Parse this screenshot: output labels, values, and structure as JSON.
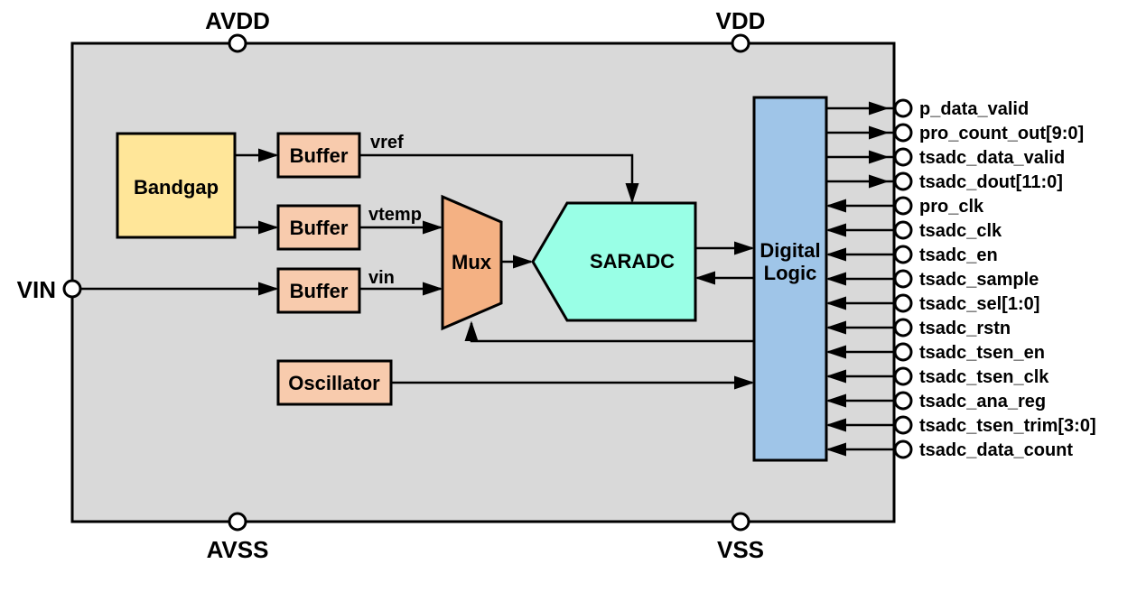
{
  "pins": {
    "avdd": "AVDD",
    "vdd": "VDD",
    "avss": "AVSS",
    "vss": "VSS",
    "vin": "VIN"
  },
  "blocks": {
    "bandgap": "Bandgap",
    "buffer1": "Buffer",
    "buffer2": "Buffer",
    "buffer3": "Buffer",
    "mux": "Mux",
    "saradc": "SARADC",
    "digital_logic_line1": "Digital",
    "digital_logic_line2": "Logic",
    "oscillator": "Oscillator"
  },
  "signals": {
    "vref": "vref",
    "vtemp": "vtemp",
    "vin": "vin"
  },
  "right_pins": [
    "p_data_valid",
    "pro_count_out[9:0]",
    "tsadc_data_valid",
    "tsadc_dout[11:0]",
    "pro_clk",
    "tsadc_clk",
    "tsadc_en",
    "tsadc_sample",
    "tsadc_sel[1:0]",
    "tsadc_rstn",
    "tsadc_tsen_en",
    "tsadc_tsen_clk",
    "tsadc_ana_reg",
    "tsadc_tsen_trim[3:0]",
    "tsadc_data_count"
  ],
  "right_pin_directions": [
    "out",
    "out",
    "out",
    "out",
    "in",
    "in",
    "in",
    "in",
    "in",
    "in",
    "in",
    "in",
    "in",
    "in",
    "in"
  ]
}
